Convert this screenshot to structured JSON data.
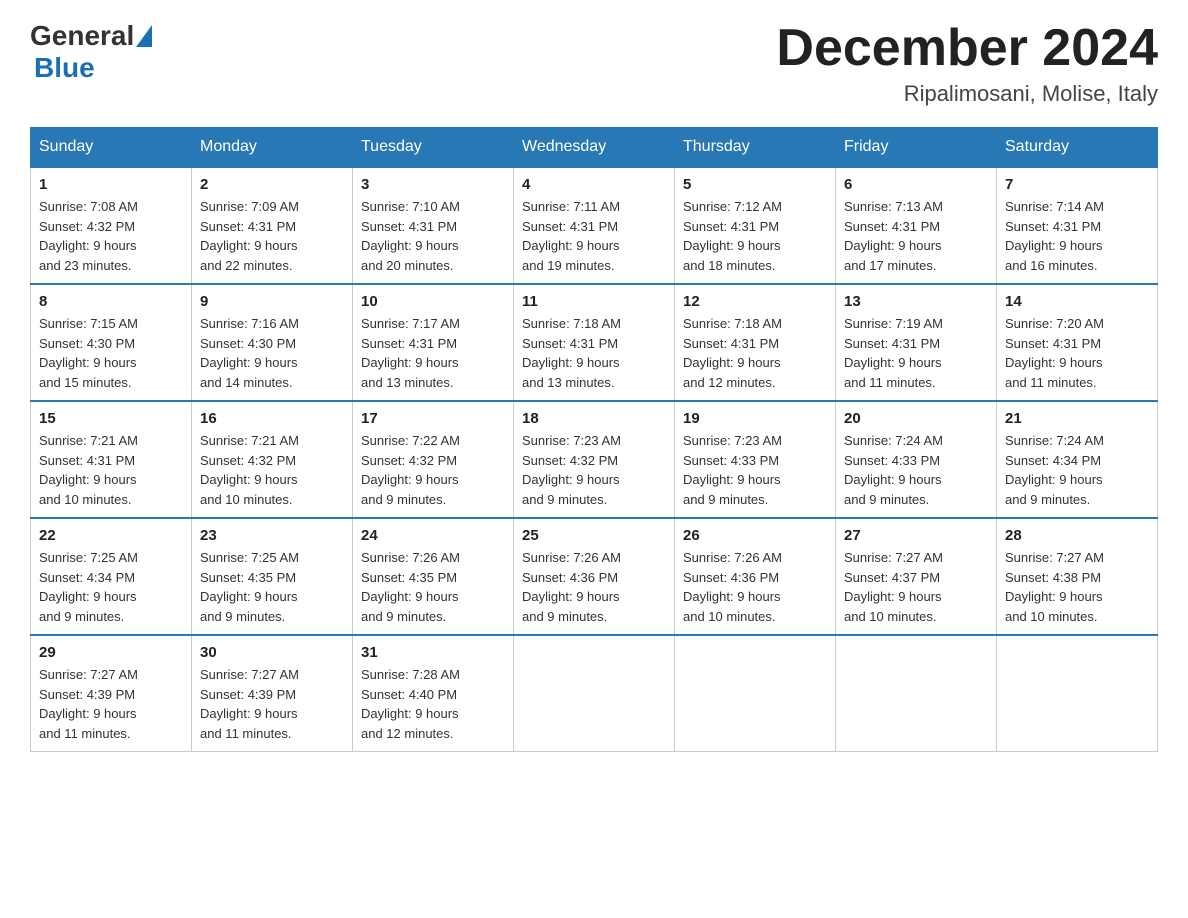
{
  "header": {
    "logo_general": "General",
    "logo_blue": "Blue",
    "month_title": "December 2024",
    "location": "Ripalimosani, Molise, Italy"
  },
  "days_of_week": [
    "Sunday",
    "Monday",
    "Tuesday",
    "Wednesday",
    "Thursday",
    "Friday",
    "Saturday"
  ],
  "weeks": [
    [
      {
        "day": "1",
        "sunrise": "7:08 AM",
        "sunset": "4:32 PM",
        "daylight": "9 hours and 23 minutes."
      },
      {
        "day": "2",
        "sunrise": "7:09 AM",
        "sunset": "4:31 PM",
        "daylight": "9 hours and 22 minutes."
      },
      {
        "day": "3",
        "sunrise": "7:10 AM",
        "sunset": "4:31 PM",
        "daylight": "9 hours and 20 minutes."
      },
      {
        "day": "4",
        "sunrise": "7:11 AM",
        "sunset": "4:31 PM",
        "daylight": "9 hours and 19 minutes."
      },
      {
        "day": "5",
        "sunrise": "7:12 AM",
        "sunset": "4:31 PM",
        "daylight": "9 hours and 18 minutes."
      },
      {
        "day": "6",
        "sunrise": "7:13 AM",
        "sunset": "4:31 PM",
        "daylight": "9 hours and 17 minutes."
      },
      {
        "day": "7",
        "sunrise": "7:14 AM",
        "sunset": "4:31 PM",
        "daylight": "9 hours and 16 minutes."
      }
    ],
    [
      {
        "day": "8",
        "sunrise": "7:15 AM",
        "sunset": "4:30 PM",
        "daylight": "9 hours and 15 minutes."
      },
      {
        "day": "9",
        "sunrise": "7:16 AM",
        "sunset": "4:30 PM",
        "daylight": "9 hours and 14 minutes."
      },
      {
        "day": "10",
        "sunrise": "7:17 AM",
        "sunset": "4:31 PM",
        "daylight": "9 hours and 13 minutes."
      },
      {
        "day": "11",
        "sunrise": "7:18 AM",
        "sunset": "4:31 PM",
        "daylight": "9 hours and 13 minutes."
      },
      {
        "day": "12",
        "sunrise": "7:18 AM",
        "sunset": "4:31 PM",
        "daylight": "9 hours and 12 minutes."
      },
      {
        "day": "13",
        "sunrise": "7:19 AM",
        "sunset": "4:31 PM",
        "daylight": "9 hours and 11 minutes."
      },
      {
        "day": "14",
        "sunrise": "7:20 AM",
        "sunset": "4:31 PM",
        "daylight": "9 hours and 11 minutes."
      }
    ],
    [
      {
        "day": "15",
        "sunrise": "7:21 AM",
        "sunset": "4:31 PM",
        "daylight": "9 hours and 10 minutes."
      },
      {
        "day": "16",
        "sunrise": "7:21 AM",
        "sunset": "4:32 PM",
        "daylight": "9 hours and 10 minutes."
      },
      {
        "day": "17",
        "sunrise": "7:22 AM",
        "sunset": "4:32 PM",
        "daylight": "9 hours and 9 minutes."
      },
      {
        "day": "18",
        "sunrise": "7:23 AM",
        "sunset": "4:32 PM",
        "daylight": "9 hours and 9 minutes."
      },
      {
        "day": "19",
        "sunrise": "7:23 AM",
        "sunset": "4:33 PM",
        "daylight": "9 hours and 9 minutes."
      },
      {
        "day": "20",
        "sunrise": "7:24 AM",
        "sunset": "4:33 PM",
        "daylight": "9 hours and 9 minutes."
      },
      {
        "day": "21",
        "sunrise": "7:24 AM",
        "sunset": "4:34 PM",
        "daylight": "9 hours and 9 minutes."
      }
    ],
    [
      {
        "day": "22",
        "sunrise": "7:25 AM",
        "sunset": "4:34 PM",
        "daylight": "9 hours and 9 minutes."
      },
      {
        "day": "23",
        "sunrise": "7:25 AM",
        "sunset": "4:35 PM",
        "daylight": "9 hours and 9 minutes."
      },
      {
        "day": "24",
        "sunrise": "7:26 AM",
        "sunset": "4:35 PM",
        "daylight": "9 hours and 9 minutes."
      },
      {
        "day": "25",
        "sunrise": "7:26 AM",
        "sunset": "4:36 PM",
        "daylight": "9 hours and 9 minutes."
      },
      {
        "day": "26",
        "sunrise": "7:26 AM",
        "sunset": "4:36 PM",
        "daylight": "9 hours and 10 minutes."
      },
      {
        "day": "27",
        "sunrise": "7:27 AM",
        "sunset": "4:37 PM",
        "daylight": "9 hours and 10 minutes."
      },
      {
        "day": "28",
        "sunrise": "7:27 AM",
        "sunset": "4:38 PM",
        "daylight": "9 hours and 10 minutes."
      }
    ],
    [
      {
        "day": "29",
        "sunrise": "7:27 AM",
        "sunset": "4:39 PM",
        "daylight": "9 hours and 11 minutes."
      },
      {
        "day": "30",
        "sunrise": "7:27 AM",
        "sunset": "4:39 PM",
        "daylight": "9 hours and 11 minutes."
      },
      {
        "day": "31",
        "sunrise": "7:28 AM",
        "sunset": "4:40 PM",
        "daylight": "9 hours and 12 minutes."
      },
      null,
      null,
      null,
      null
    ]
  ],
  "labels": {
    "sunrise": "Sunrise:",
    "sunset": "Sunset:",
    "daylight": "Daylight:"
  }
}
